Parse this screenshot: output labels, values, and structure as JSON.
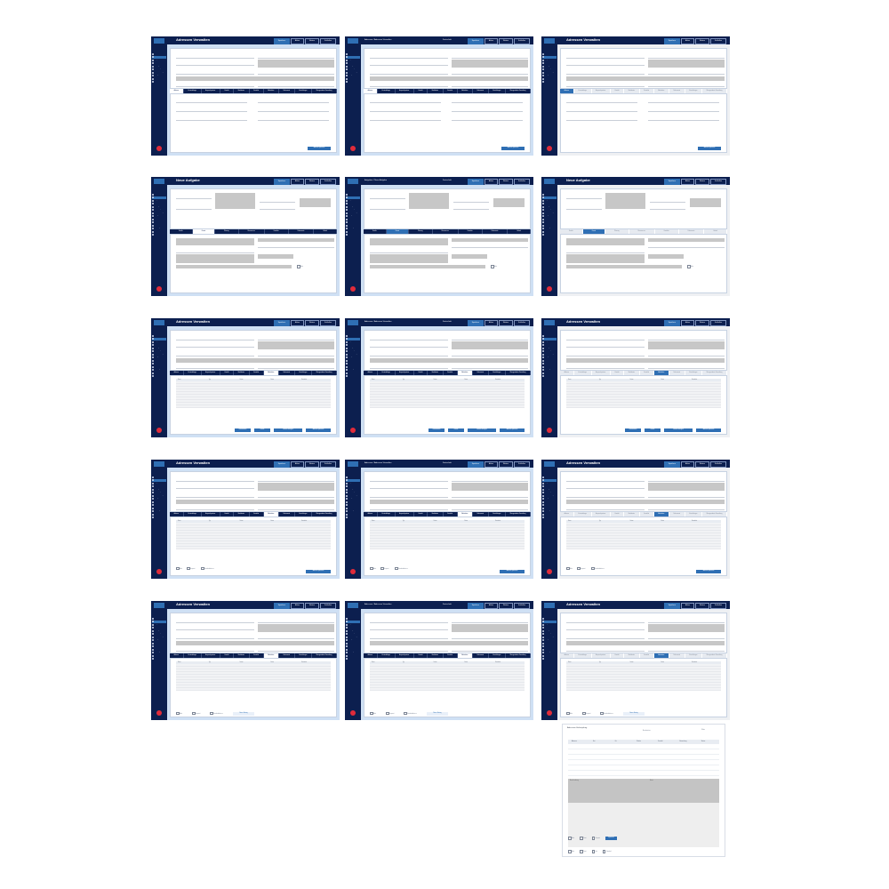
{
  "colors": {
    "navy": "#0c1f4f",
    "accent": "#2f6fb4",
    "page_blue": "#cfe0f4",
    "danger": "#e12b3a",
    "placeholder_grey": "#c7c7c7"
  },
  "header": {
    "title_admin": "Adressen Verwalten",
    "title_task": "Neue Aufgabe",
    "crumb_admin": "Adressen / Adressen Verwalten",
    "crumb_task": "Aufgaben / Neue Aufgabe",
    "progress": "Fortschritt",
    "btn_save": "Speichern",
    "btn_action": "Aktion",
    "btn_more": "Weitere",
    "btn_close": "Schließen"
  },
  "sidebar": {
    "items": [
      "Start",
      "Adressen",
      "Projekt",
      "Kunden",
      "Aufträge",
      "Rechnung",
      "Zeiterfassung",
      "Belege",
      "Personal",
      "Mitarbeiter",
      "Dokumente",
      "Planung",
      "Kontakte",
      "Hilfe"
    ]
  },
  "tabs_admin": [
    "Adresse",
    "Zusatzabfrage",
    "Ansprechpartner",
    "Kontakt",
    "Bankdaten",
    "Kontakte",
    "Aktivitäten",
    "Dokumente",
    "Einstellungen",
    "Übergeordnete Verwaltung"
  ],
  "tabs_task": [
    "Details",
    "Zusatz",
    "Planung",
    "Ressourcen",
    "Kontakte",
    "Dokumente",
    "Verlauf"
  ],
  "table_headers": [
    "Name",
    "Typ",
    "Datum",
    "Status",
    "Bearbeitet"
  ],
  "actions": {
    "confirm": "Übernehmen",
    "details": "Details",
    "history": "Historie anzeigen",
    "save_address": "Adresse speichern",
    "new_entry": "Neuer Eintrag"
  },
  "checkboxes": {
    "active": "Aktiv",
    "locked": "Gesperrt",
    "default": "Standardadresse",
    "archive": "Archivieren"
  },
  "card": {
    "title": "Adressen-Verknüpfung",
    "meta_left": "Bearbeiten",
    "meta_right": "Filter",
    "headers": [
      "Adresse",
      "Art",
      "Ort",
      "Telefon",
      "Kontakt",
      "Bemerkung",
      "Status"
    ],
    "gblock_left": "Beschreibung",
    "gblock_right": "Notiz",
    "foot_save": "Speichern",
    "checks": [
      "Aktiv",
      "Privat",
      "Gesperrt"
    ],
    "checks2": [
      "Aktiv",
      "Privat",
      "Info",
      "Standard"
    ]
  }
}
